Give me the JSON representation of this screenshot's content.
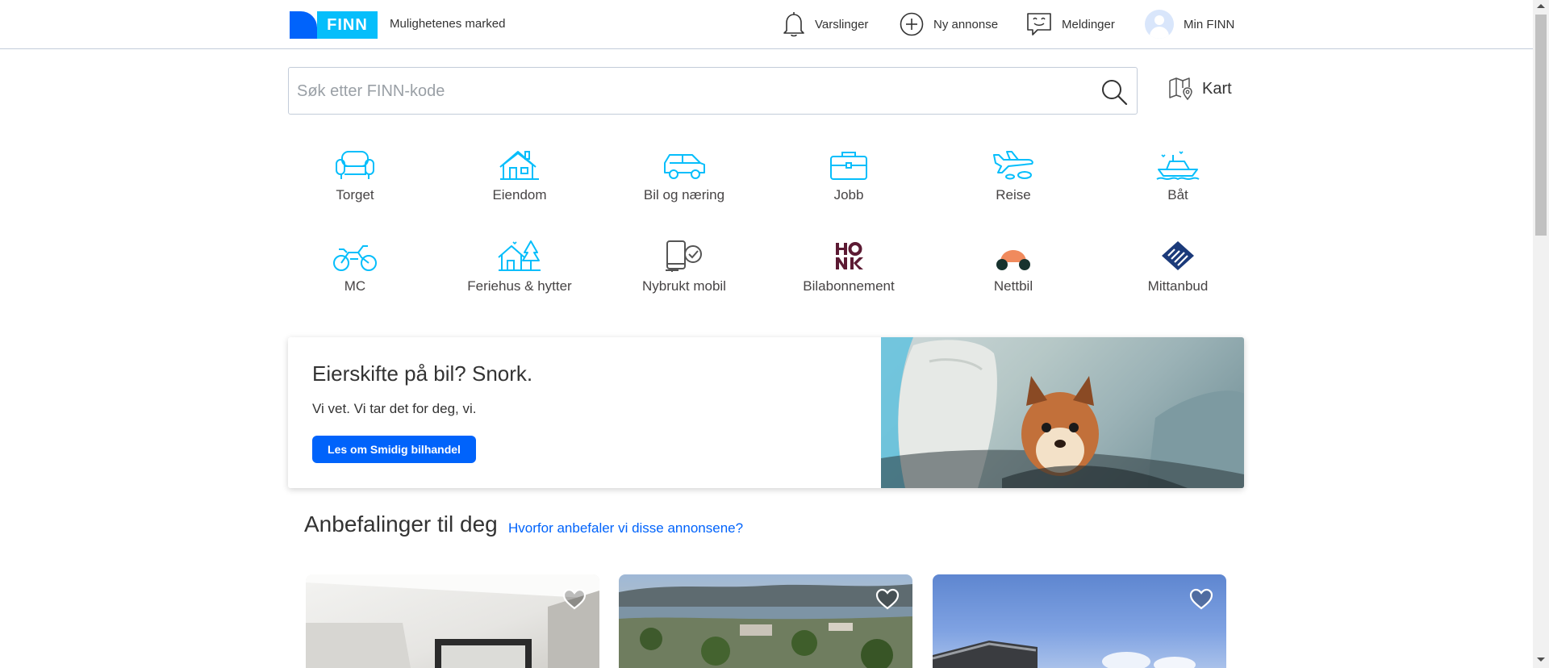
{
  "header": {
    "logo_text": "FINN",
    "tagline": "Mulighetenes marked",
    "nav": {
      "varslinger": "Varslinger",
      "ny_annonse": "Ny annonse",
      "meldinger": "Meldinger",
      "min_finn": "Min FINN"
    }
  },
  "search": {
    "placeholder": "Søk etter FINN-kode",
    "value": "",
    "map_label": "Kart"
  },
  "categories": [
    {
      "label": "Torget",
      "icon": "sofa-icon"
    },
    {
      "label": "Eiendom",
      "icon": "house-icon"
    },
    {
      "label": "Bil og næring",
      "icon": "car-icon"
    },
    {
      "label": "Jobb",
      "icon": "briefcase-icon"
    },
    {
      "label": "Reise",
      "icon": "airplane-icon"
    },
    {
      "label": "Båt",
      "icon": "boat-icon"
    },
    {
      "label": "MC",
      "icon": "motorcycle-icon"
    },
    {
      "label": "Feriehus & hytter",
      "icon": "cabin-icon"
    },
    {
      "label": "Nybrukt mobil",
      "icon": "mobile-icon"
    },
    {
      "label": "Bilabonnement",
      "icon": "honk-logo"
    },
    {
      "label": "Nettbil",
      "icon": "nettbil-logo"
    },
    {
      "label": "Mittanbud",
      "icon": "mittanbud-logo"
    }
  ],
  "promo": {
    "title": "Eierskifte på bil? Snork.",
    "subtitle": "Vi vet. Vi tar det for deg, vi.",
    "button": "Les om Smidig bilhandel"
  },
  "recommendations": {
    "title": "Anbefalinger til deg",
    "link": "Hvorfor anbefaler vi disse annonsene?"
  },
  "colors": {
    "brand_blue": "#0063fb",
    "brand_cyan": "#06befb",
    "icon_cyan": "#06befb",
    "honk": "#5c1a33"
  }
}
